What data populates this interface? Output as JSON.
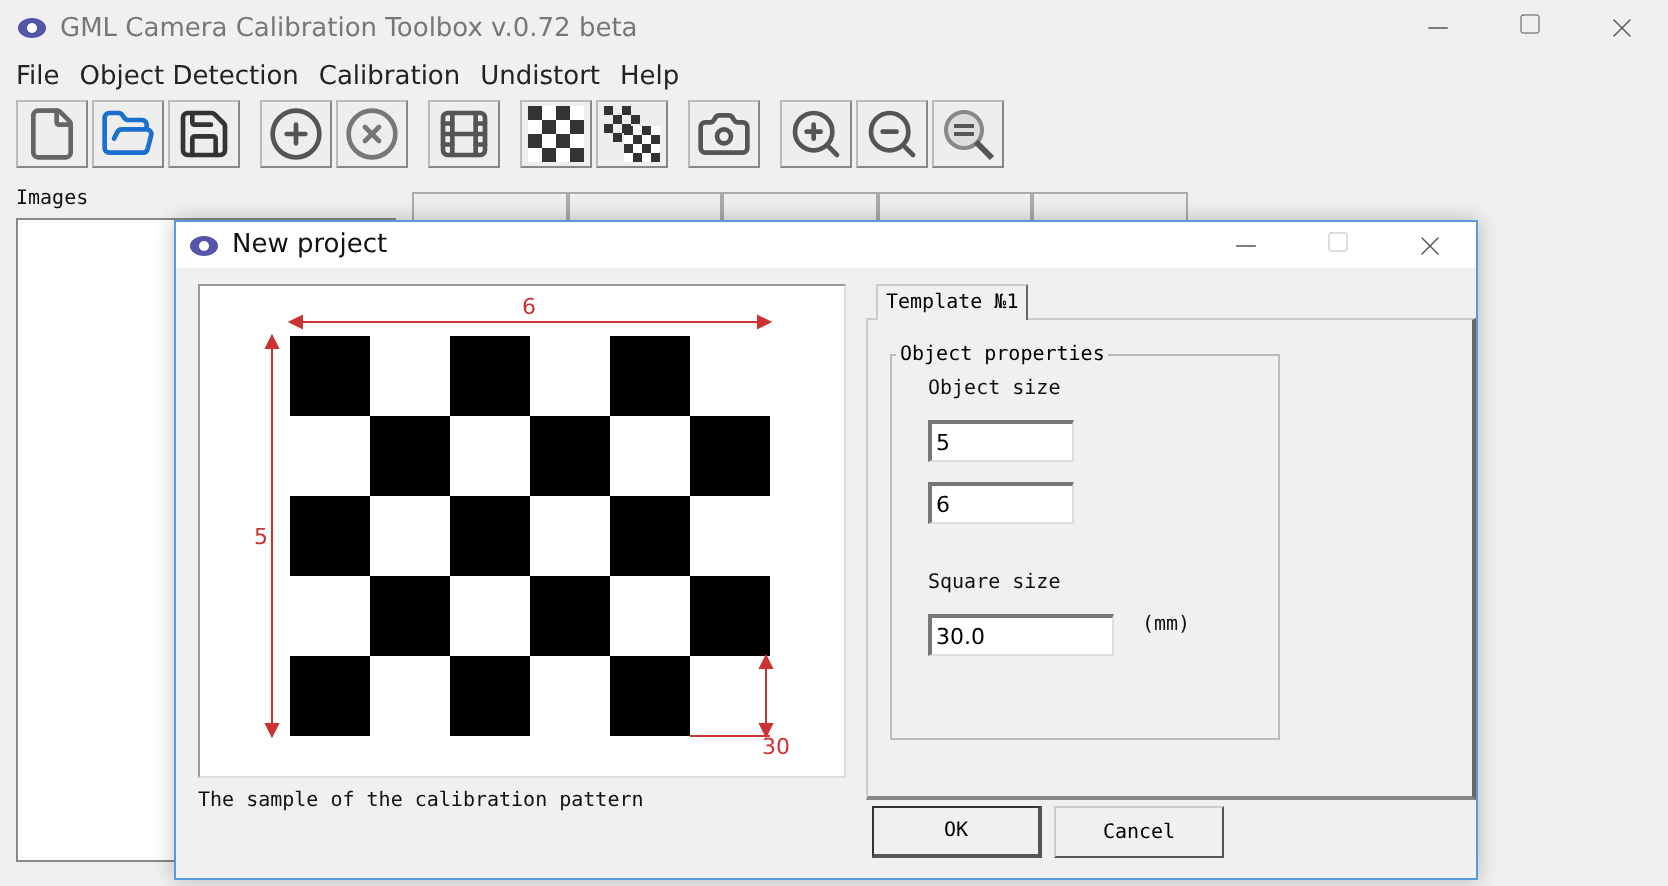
{
  "window": {
    "title": "GML Camera Calibration Toolbox  v.0.72 beta"
  },
  "menu": [
    "File",
    "Object Detection",
    "Calibration",
    "Undistort",
    "Help"
  ],
  "images_panel": {
    "label": "Images"
  },
  "dialog": {
    "title": "New project",
    "pattern": {
      "width_label": "6",
      "height_label": "5",
      "square_label": "30"
    },
    "caption": "The sample of the calibration pattern",
    "tabs": [
      {
        "label": "Template №1",
        "selected": true
      }
    ],
    "group": {
      "title": "Object properties",
      "size_label": "Object size",
      "size_values": [
        "5",
        "6"
      ],
      "square_label": "Square size",
      "square_value": "30.0",
      "unit": "(mm)"
    },
    "buttons": [
      "OK",
      "Cancel"
    ]
  }
}
